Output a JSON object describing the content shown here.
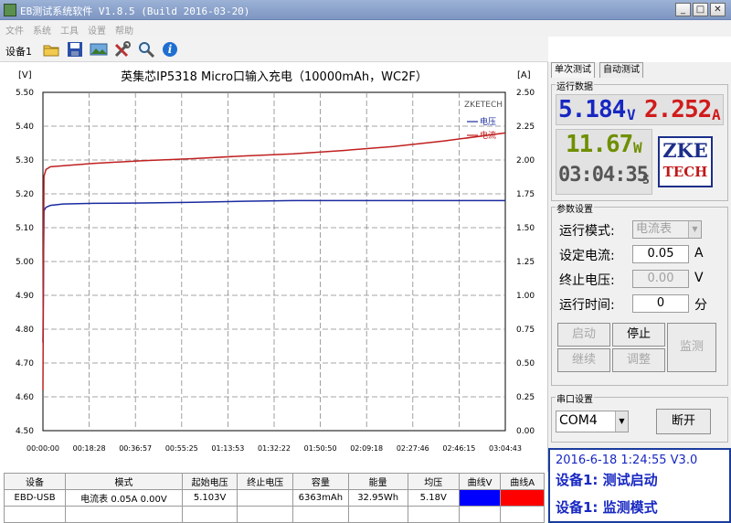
{
  "window": {
    "title": "EB测试系统软件  V1.8.5  (Build 2016-03-20)",
    "min": "_",
    "max": "□",
    "close": "✕"
  },
  "menu": [
    "文件",
    "系统",
    "工具",
    "设置",
    "帮助"
  ],
  "toolbar": {
    "device_label": "设备1",
    "icons": [
      "open-folder-icon",
      "save-icon",
      "picture-icon",
      "tools-icon",
      "zoom-icon",
      "info-icon"
    ]
  },
  "chart_data": {
    "type": "line",
    "title": "英集芯IP5318 Micro口输入充电（10000mAh，WC2F）",
    "left_unit": "[V]",
    "right_unit": "[A]",
    "watermark": "ZKETECH",
    "ylim_left": [
      4.5,
      5.5
    ],
    "ylim_right": [
      0,
      2.5
    ],
    "yticks_left": [
      "5.50",
      "5.40",
      "5.30",
      "5.20",
      "5.10",
      "5.00",
      "4.90",
      "4.80",
      "4.70",
      "4.60",
      "4.50"
    ],
    "yticks_right": [
      "2.50",
      "2.25",
      "2.00",
      "1.75",
      "1.50",
      "1.25",
      "1.00",
      "0.75",
      "0.50",
      "0.25",
      "0.00"
    ],
    "xticks": [
      "00:00:00",
      "00:18:28",
      "00:36:57",
      "00:55:25",
      "01:13:53",
      "01:32:22",
      "01:50:50",
      "02:09:18",
      "02:27:46",
      "02:46:15",
      "03:04:43"
    ],
    "grid": true,
    "legend": "top-right",
    "series": [
      {
        "name": "电压",
        "axis": "left",
        "color": "#1a2ba0",
        "x_min": [
          0,
          0.4,
          1.2,
          3,
          8,
          20,
          40,
          60,
          80,
          100,
          120,
          140,
          160,
          184.7
        ],
        "values": [
          4.76,
          5.15,
          5.16,
          5.166,
          5.17,
          5.172,
          5.173,
          5.175,
          5.178,
          5.18,
          5.18,
          5.18,
          5.18,
          5.18
        ]
      },
      {
        "name": "电流",
        "axis": "right",
        "color": "#c02020",
        "x_min": [
          0,
          0.4,
          1.2,
          3,
          10,
          20,
          40,
          60,
          80,
          100,
          120,
          140,
          160,
          184.7
        ],
        "values": [
          0.3,
          1.88,
          1.93,
          1.95,
          1.96,
          1.975,
          1.995,
          2.01,
          2.03,
          2.045,
          2.07,
          2.1,
          2.14,
          2.2
        ]
      }
    ]
  },
  "table": {
    "headers": [
      "设备",
      "模式",
      "起始电压",
      "终止电压",
      "容量",
      "能量",
      "均压",
      "曲线V",
      "曲线A"
    ],
    "row": {
      "device": "EBD-USB",
      "mode": "电流表  0.05A  0.00V",
      "start_v": "5.103V",
      "end_v": "",
      "capacity": "6363mAh",
      "energy": "32.95Wh",
      "avg_v": "5.18V",
      "curve_v_color": "#0000ff",
      "curve_a_color": "#ff0000"
    }
  },
  "panel": {
    "tabs": [
      "单次测试",
      "自动测试"
    ],
    "run_group": "运行数据",
    "voltage": "5.184",
    "voltage_unit": "V",
    "current": "2.252",
    "current_unit": "A",
    "power": "11.67",
    "power_unit": "W",
    "time": "03:04:35",
    "time_unit": "S",
    "logo_top": "ZKE",
    "logo_bottom": "TECH",
    "param_group": "参数设置",
    "mode_label": "运行模式:",
    "mode_value": "电流表",
    "set_current_label": "设定电流:",
    "set_current_value": "0.05",
    "set_current_unit": "A",
    "end_v_label": "终止电压:",
    "end_v_value": "0.00",
    "end_v_unit": "V",
    "run_time_label": "运行时间:",
    "run_time_value": "0",
    "run_time_unit": "分",
    "btn_start": "启动",
    "btn_stop": "停止",
    "btn_continue": "继续",
    "btn_adjust": "调整",
    "btn_monitor": "监测",
    "serial_group": "串口设置",
    "port": "COM4",
    "btn_disconnect": "断开",
    "log_time": "2016-6-18  1:24:55  V3.0",
    "log_line1": "设备1: 测试启动",
    "log_line2": "设备1: 监测模式"
  }
}
